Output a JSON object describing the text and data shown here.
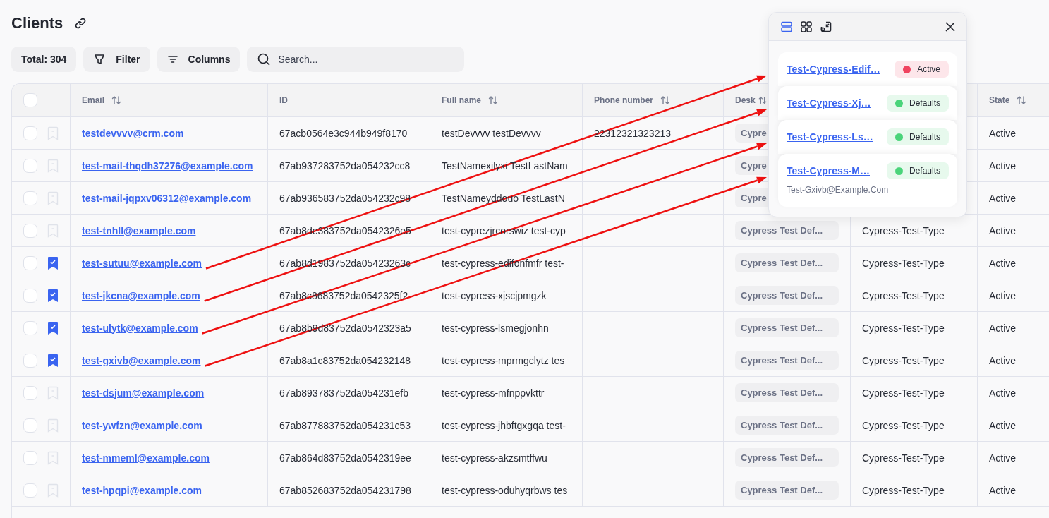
{
  "page": {
    "title": "Clients"
  },
  "toolbar": {
    "total": "Total: 304",
    "filter": "Filter",
    "columns": "Columns",
    "search_placeholder": "Search..."
  },
  "table": {
    "header_checked": false,
    "columns": [
      {
        "label": "Email",
        "sortable": true
      },
      {
        "label": "ID",
        "sortable": false
      },
      {
        "label": "Full name",
        "sortable": true
      },
      {
        "label": "Phone number",
        "sortable": true
      },
      {
        "label": "Desk",
        "sortable": true
      },
      {
        "label": "State",
        "sortable": true
      }
    ],
    "rows": [
      {
        "checked": false,
        "bookmarked": false,
        "email": "testdevvvv@crm.com",
        "id": "67acb0564e3c944b949f8170",
        "full_name": "testDevvvv testDevvvv",
        "phone": "22312321323213",
        "desk": "Cypre",
        "state": "Active"
      },
      {
        "checked": false,
        "bookmarked": false,
        "email": "test-mail-thqdh37276@example.com",
        "id": "67ab937283752da054232cc8",
        "full_name": "TestNamexilyxi TestLastNam",
        "desk": "Cypre",
        "state": "Active"
      },
      {
        "checked": false,
        "bookmarked": false,
        "email": "test-mail-jqpxv06312@example.com",
        "id": "67ab936583752da054232c98",
        "full_name": "TestNameyddouo TestLastN",
        "desk": "Cypre",
        "state": "Active"
      },
      {
        "checked": false,
        "bookmarked": false,
        "email": "test-tnhll@example.com",
        "id": "67ab8de383752da0542326e5",
        "full_name": "test-cyprezjrcorswiz test-cyp",
        "desk": "Cypress Test Def...",
        "type": "Cypress-Test-Type",
        "state": "Active"
      },
      {
        "checked": false,
        "bookmarked": true,
        "email": "test-sutuu@example.com",
        "id": "67ab8d1983752da05423263c",
        "full_name": "test-cypress-edifonfmfr test-",
        "desk": "Cypress Test Def...",
        "type": "Cypress-Test-Type",
        "state": "Active"
      },
      {
        "checked": false,
        "bookmarked": true,
        "email": "test-jkcna@example.com",
        "id": "67ab8c8683752da0542325f2",
        "full_name": "test-cypress-xjscjpmgzk",
        "desk": "Cypress Test Def...",
        "type": "Cypress-Test-Type",
        "state": "Active"
      },
      {
        "checked": false,
        "bookmarked": true,
        "email": "test-ulytk@example.com",
        "id": "67ab8b9d83752da0542323a5",
        "full_name": "test-cypress-lsmegjonhn",
        "desk": "Cypress Test Def...",
        "type": "Cypress-Test-Type",
        "state": "Active"
      },
      {
        "checked": false,
        "bookmarked": true,
        "email": "test-gxivb@example.com",
        "id": "67ab8a1c83752da054232148",
        "full_name": "test-cypress-mprmgclytz tes",
        "desk": "Cypress Test Def...",
        "type": "Cypress-Test-Type",
        "state": "Active"
      },
      {
        "checked": false,
        "bookmarked": false,
        "email": "test-dsjum@example.com",
        "id": "67ab893783752da054231efb",
        "full_name": "test-cypress-mfnppvkttr",
        "desk": "Cypress Test Def...",
        "type": "Cypress-Test-Type",
        "state": "Active"
      },
      {
        "checked": false,
        "bookmarked": false,
        "email": "test-ywfzn@example.com",
        "id": "67ab877883752da054231c53",
        "full_name": "test-cypress-jhbftgxgqa test-",
        "desk": "Cypress Test Def...",
        "type": "Cypress-Test-Type",
        "state": "Active"
      },
      {
        "checked": false,
        "bookmarked": false,
        "email": "test-mmeml@example.com",
        "id": "67ab864d83752da0542319ee",
        "full_name": "test-cypress-akzsmtffwu",
        "desk": "Cypress Test Def...",
        "type": "Cypress-Test-Type",
        "state": "Active"
      },
      {
        "checked": false,
        "bookmarked": false,
        "email": "test-hpqpi@example.com",
        "id": "67ab852683752da054231798",
        "full_name": "test-cypress-oduhyqrbws tes",
        "desk": "Cypress Test Def...",
        "type": "Cypress-Test-Type",
        "state": "Active"
      }
    ]
  },
  "popover": {
    "view_modes": [
      {
        "kind": "list",
        "selected": true
      },
      {
        "kind": "grid",
        "selected": false
      },
      {
        "kind": "minimize",
        "selected": false
      }
    ],
    "cards": [
      {
        "name": "Test-Cypress-Edif…",
        "status": "Active",
        "color": "#f0435f"
      },
      {
        "name": "Test-Cypress-Xj…",
        "status": "Defaults",
        "color": "#4ad47a"
      },
      {
        "name": "Test-Cypress-Ls…",
        "status": "Defaults",
        "color": "#4ad47a"
      },
      {
        "name": "Test-Cypress-M…",
        "status": "Defaults",
        "color": "#4ad47a",
        "email": "Test-Gxivb@Example.Com"
      }
    ]
  }
}
